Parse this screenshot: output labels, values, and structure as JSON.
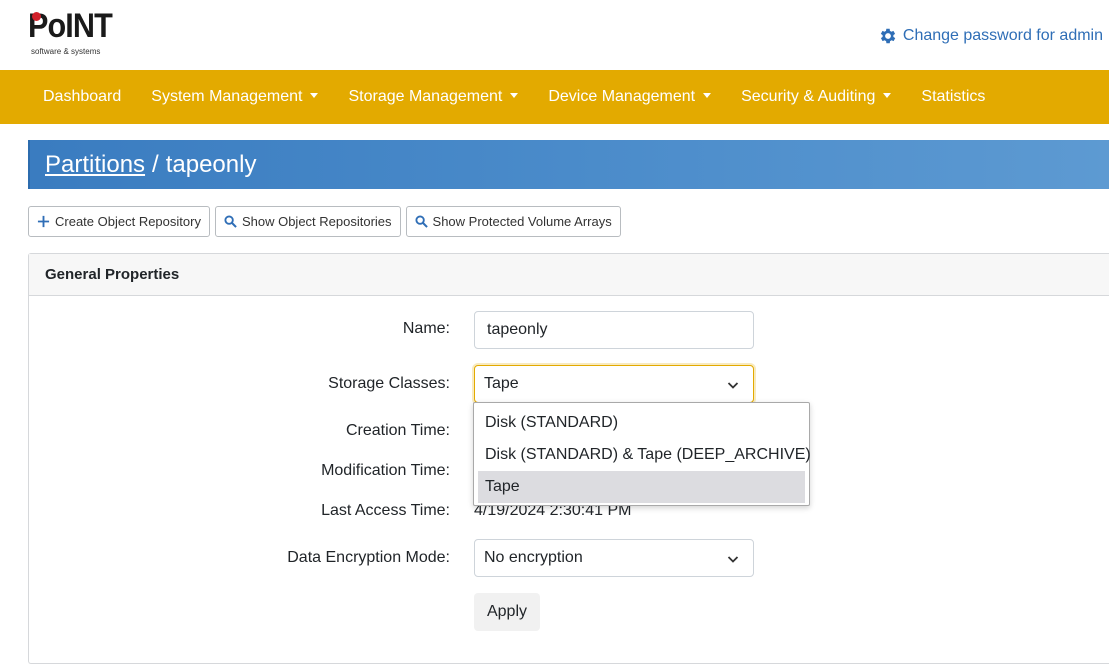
{
  "header": {
    "logo_text": "PoINT",
    "logo_sub": "software & systems",
    "change_password": "Change password for admin"
  },
  "nav": {
    "items": [
      {
        "label": "Dashboard",
        "caret": false
      },
      {
        "label": "System Management",
        "caret": true
      },
      {
        "label": "Storage Management",
        "caret": true
      },
      {
        "label": "Device Management",
        "caret": true
      },
      {
        "label": "Security & Auditing",
        "caret": true
      },
      {
        "label": "Statistics",
        "caret": false
      }
    ]
  },
  "breadcrumb": {
    "link": "Partitions",
    "separator": "/",
    "current": "tapeonly"
  },
  "actions": {
    "create": "Create Object Repository",
    "show_repos": "Show Object Repositories",
    "show_arrays": "Show Protected Volume Arrays"
  },
  "card": {
    "title": "General Properties"
  },
  "form": {
    "name_label": "Name:",
    "name_value": "tapeonly",
    "storage_label": "Storage Classes:",
    "storage_value": "Tape",
    "creation_label": "Creation Time:",
    "modification_label": "Modification Time:",
    "last_access_label": "Last Access Time:",
    "last_access_value": "4/19/2024 2:30:41 PM",
    "encryption_label": "Data Encryption Mode:",
    "encryption_value": "No encryption",
    "apply_label": "Apply"
  },
  "dropdown": {
    "options": [
      "Disk (STANDARD)",
      "Disk (STANDARD) & Tape (DEEP_ARCHIVE)",
      "Tape"
    ],
    "selected": "Tape"
  },
  "colors": {
    "navbar": "#e3aa00",
    "banner": "#4a8bca",
    "link": "#2f6eb6",
    "logo_dot": "#d0202a"
  }
}
